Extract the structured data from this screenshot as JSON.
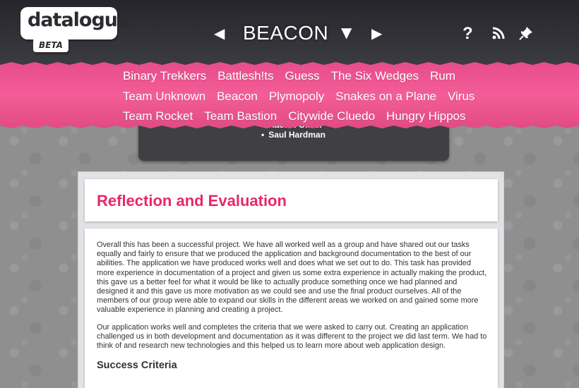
{
  "header": {
    "logo_text": "datalogue",
    "beta_label": "BETA",
    "prev_glyph": "◀",
    "project_title": "BEACON",
    "dropdown_glyph": "▼",
    "next_glyph": "▶",
    "help_glyph": "?",
    "icons": [
      "help-icon",
      "rss-icon",
      "pin-icon"
    ]
  },
  "project_nav": {
    "rows": [
      [
        "Binary Trekkers",
        "Battlesh!ts",
        "Guess",
        "The Six Wedges",
        "Rum"
      ],
      [
        "Team Unknown",
        "Beacon",
        "Plymopoly",
        "Snakes on a Plane",
        "Virus"
      ],
      [
        "Team Rocket",
        "Team Bastion",
        "Citywide Cluedo",
        "Hungry Hippos"
      ]
    ]
  },
  "members": [
    "Rachel Oliver",
    "Saul Hardman"
  ],
  "content": {
    "heading": "Reflection and Evaluation",
    "paragraphs": [
      "Overall this has been a successful project. We have all worked well as a group and have shared out our tasks equally and fairly to ensure that we produced the application and background documentation to the best of our abilities. The application we have produced works well and does what we set out to do. This task has provided more experience in documentation of a project and given us some extra experience in actually making the product, this gave us a better feel for what it would be like to actually produce something once we had planned and designed it and this gave us more motivation as we could see and use the final product ourselves. All of the members of our group were able to expand our skills in the different areas we worked on and gained some more valuable experience in planning and creating a project.",
      "Our application works well and completes the criteria that we were asked to carry out. Creating an application challenged us in both development and documentation as it was different to the project we did last term. We had to think of and research new technologies and this helped us to learn more about web application design."
    ],
    "subheading": "Success Criteria"
  },
  "colors": {
    "accent_pink": "#e8276d",
    "nav_band": "#f45d98",
    "header_dark": "#2f2f35"
  }
}
